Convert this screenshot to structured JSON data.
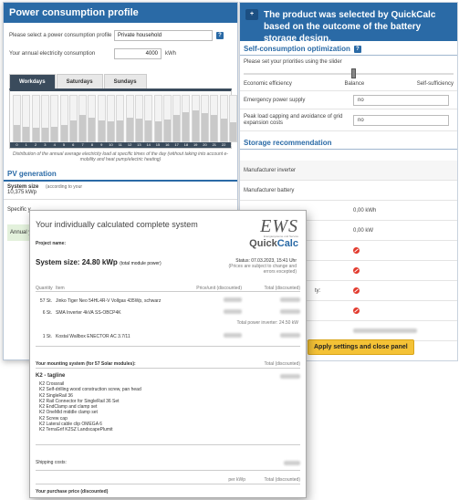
{
  "left_panel": {
    "title": "Power consumption profile",
    "consumption_profile_label": "Please select a power consumption profile",
    "consumption_profile_value": "Private household",
    "help_label": "?",
    "annual_consumption_label": "Your annual electricity consumption",
    "annual_consumption_value": "4000",
    "annual_consumption_unit": "kWh",
    "tabs": [
      "Workdays",
      "Saturdays",
      "Sundays"
    ],
    "hours": [
      "0",
      "1",
      "2",
      "3",
      "4",
      "5",
      "6",
      "7",
      "8",
      "9",
      "10",
      "11",
      "12",
      "13",
      "14",
      "15",
      "16",
      "17",
      "18",
      "19",
      "20",
      "21",
      "22",
      "23"
    ],
    "hourly_levels": [
      0.35,
      0.3,
      0.28,
      0.28,
      0.3,
      0.34,
      0.45,
      0.55,
      0.5,
      0.45,
      0.42,
      0.45,
      0.5,
      0.48,
      0.44,
      0.42,
      0.46,
      0.55,
      0.62,
      0.65,
      0.6,
      0.55,
      0.48,
      0.4
    ],
    "chart_note": "Distribution of the annual average electricity load at specific times of the day (without taking into account e-mobility and heat pump/electric heating)",
    "pv_title": "PV generation",
    "system_size_label": "System size",
    "system_size_value": "10,375 kWp",
    "system_size_note": "(according to your",
    "specific_label": "Specific y",
    "annual_label": "Annual yi"
  },
  "right_panel": {
    "header_icon": "+",
    "header_text": "The product was selected by QuickCalc based on the outcome of the battery storage design.",
    "self_consumption_title": "Self-consumption optimization",
    "help_label": "?",
    "priorities_label": "Please set your priorities using the slider",
    "slider_left": "Economic efficiency",
    "slider_mid": "Balance",
    "slider_right": "Self-sufficiency",
    "emergency_label": "Emergency power supply",
    "emergency_value": "no",
    "peak_label": "Peak load capping and avoidance of grid expansion costs",
    "peak_value": "no",
    "storage_title": "Storage recommendation",
    "manufacturer_inverter": "Manufacturer inverter",
    "manufacturer_battery": "Manufacturer battery",
    "value_kwh": "0,00 kWh",
    "value_kw": "0,00 kW",
    "ty_label": "ty:",
    "apply_button": "Apply settings and close panel"
  },
  "overlay": {
    "title": "Your individually calculated complete system",
    "project_label": "Project name:",
    "system_size": "System size: 24.80 kWp",
    "system_size_note": "(total module power)",
    "logo_ews": "EWS",
    "logo_ews_tagline": "Energiesysteme und Service",
    "logo_quick": "Quick",
    "logo_calc": "Calc",
    "status": "Status: 07.03.2023, 15:41 Uhr",
    "status_note": "(Prices are subject to change and errors excepted)",
    "col_quantity": "Quantity",
    "col_item": "Item",
    "col_price_unit": "Price/unit (discounted)",
    "col_total": "Total (discounted)",
    "items": [
      {
        "qty": "57 St.",
        "name": "Jinko Tiger Neo 54HL4R-V Vollgas 435Wp, schwarz"
      },
      {
        "qty": "6 St.",
        "name": "SMA Inverter 4kVA SS-OBCP4K"
      },
      {
        "qty": "1 St.",
        "name": "Kostal Wallbox ENECTOR AC 3.7/11"
      }
    ],
    "total_power_note": "Total power inverter: 24.50 kW",
    "mounting_title": "Your mounting system (for 57 Solar modules):",
    "mounting_total_label": "Total (discounted)",
    "mounting_name": "K2 - tagline",
    "mounting_items": [
      "K2 Crossrail",
      "K2 Self-drilling wood construction screw, pan head",
      "K2 SingleRail 36",
      "K2 Rail Connector for SingleRail 36 Set",
      "K2 EndClamp and clamp set",
      "K2 OneMid middle clamp set",
      "K2 Screw cap",
      "K2 Lateral cable clip OMEGA 6",
      "K2 TerraGrif K2SZ LandscapePlumit"
    ],
    "shipping_label": "Shipping costs:",
    "footer_col1": "per kWp",
    "footer_col2": "Total (discounted)",
    "footer_text": "Your purchase price (discounted)"
  }
}
